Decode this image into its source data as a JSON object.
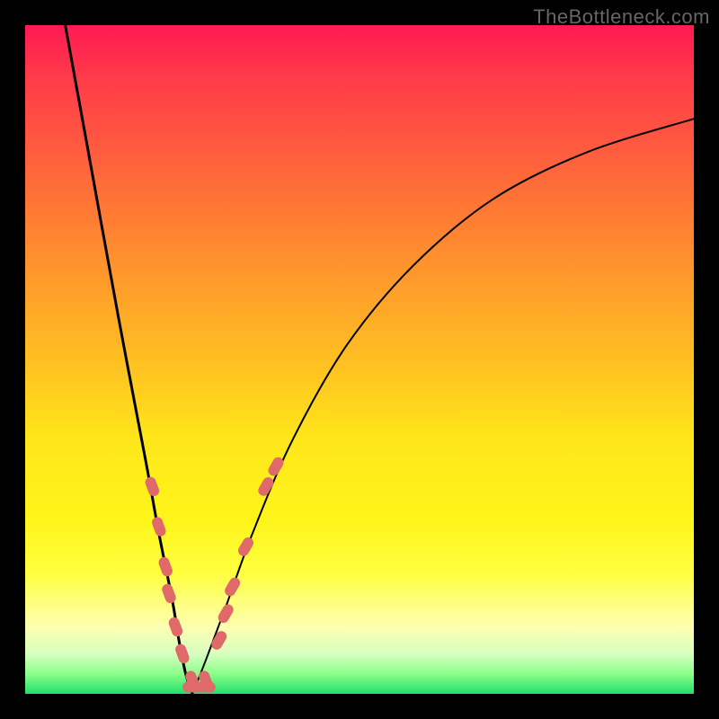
{
  "watermark": "TheBottleneck.com",
  "colors": {
    "frame": "#000000",
    "curve": "#000000",
    "markers": "#e06a6a",
    "gradient_stops": [
      "#ff1a52",
      "#ff7a34",
      "#ffe61a",
      "#fdffb0",
      "#22e06a"
    ]
  },
  "chart_data": {
    "type": "line",
    "title": "",
    "xlabel": "",
    "ylabel": "",
    "xlim": [
      0,
      100
    ],
    "ylim": [
      0,
      100
    ],
    "grid": false,
    "legend": false,
    "note": "V-shaped bottleneck curve. x ≈ component balance ratio (arbitrary 0–100), y ≈ bottleneck % (0 = none, 100 = full). Minimum ≈ x 25.",
    "series": [
      {
        "name": "left-branch",
        "x": [
          6,
          10,
          14,
          18,
          20,
          22,
          23,
          24,
          25
        ],
        "values": [
          100,
          78,
          56,
          35,
          24,
          14,
          8,
          3,
          0
        ]
      },
      {
        "name": "right-branch",
        "x": [
          25,
          27,
          30,
          34,
          40,
          48,
          58,
          70,
          84,
          100
        ],
        "values": [
          0,
          5,
          13,
          24,
          38,
          52,
          64,
          74,
          81,
          86
        ]
      }
    ],
    "markers": {
      "note": "salmon pill markers clustered around the trough",
      "left": [
        {
          "x": 19,
          "y": 31
        },
        {
          "x": 20,
          "y": 25
        },
        {
          "x": 21,
          "y": 19
        },
        {
          "x": 21.5,
          "y": 15
        },
        {
          "x": 22.5,
          "y": 10
        },
        {
          "x": 23.5,
          "y": 6
        },
        {
          "x": 25,
          "y": 2
        },
        {
          "x": 27,
          "y": 2
        }
      ],
      "right": [
        {
          "x": 29,
          "y": 8
        },
        {
          "x": 30,
          "y": 12
        },
        {
          "x": 31,
          "y": 16
        },
        {
          "x": 33,
          "y": 22
        },
        {
          "x": 36,
          "y": 31
        },
        {
          "x": 37.5,
          "y": 34
        }
      ]
    }
  }
}
